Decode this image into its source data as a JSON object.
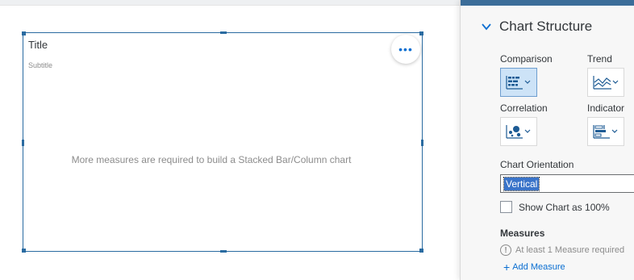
{
  "chart": {
    "title": "Title",
    "subtitle": "Subtitle",
    "more_icon": "•••",
    "empty_message": "More measures are required to build a Stacked Bar/Column chart"
  },
  "panel": {
    "section_title": "Chart Structure",
    "chart_types": [
      {
        "label": "Comparison",
        "icon": "stacked-bar-icon",
        "selected": true
      },
      {
        "label": "Trend",
        "icon": "area-chart-icon",
        "selected": false
      },
      {
        "label": "Correlation",
        "icon": "bubble-chart-icon",
        "selected": false
      },
      {
        "label": "Indicator",
        "icon": "bullet-chart-icon",
        "selected": false
      }
    ],
    "orientation_label": "Chart Orientation",
    "orientation_value": "Vertical",
    "show_100_label": "Show Chart as 100%",
    "show_100_checked": false,
    "measures_heading": "Measures",
    "measures_required": "At least 1 Measure required",
    "info_icon": "!",
    "add_plus": "+",
    "add_measure_label": "Add Measure"
  },
  "colors": {
    "accent": "#0a6ed1",
    "selection_border": "#2a6ba1",
    "selected_tile": "#cde3f7",
    "panel_bar": "#3b6d99"
  }
}
